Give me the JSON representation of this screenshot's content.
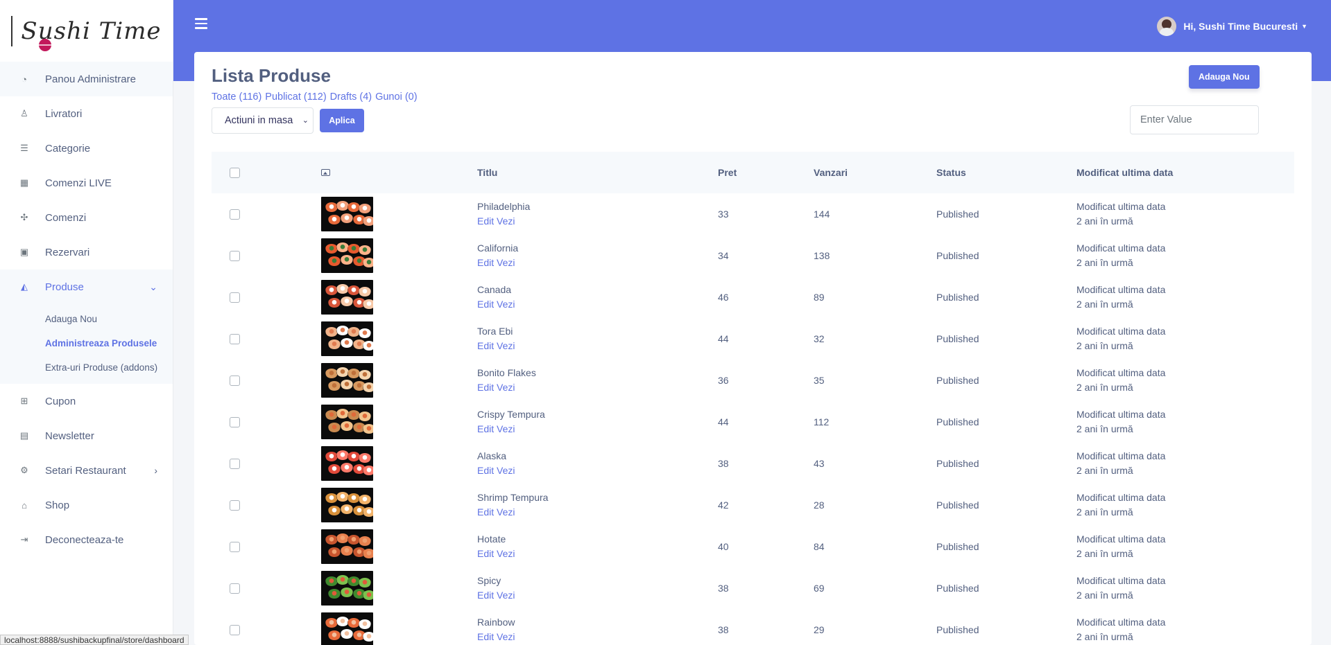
{
  "brand": {
    "logo_text": "Sushi Time"
  },
  "sidebar": {
    "items": [
      {
        "label": "Panou Administrare",
        "icon": "dashboard-icon"
      },
      {
        "label": "Livratori",
        "icon": "user-icon"
      },
      {
        "label": "Categorie",
        "icon": "list-icon"
      },
      {
        "label": "Comenzi LIVE",
        "icon": "grid-icon"
      },
      {
        "label": "Comenzi",
        "icon": "biohazard-icon"
      },
      {
        "label": "Rezervari",
        "icon": "calendar-icon"
      },
      {
        "label": "Produse",
        "icon": "pizza-slice-icon"
      },
      {
        "label": "Cupon",
        "icon": "gift-icon"
      },
      {
        "label": "Newsletter",
        "icon": "newspaper-icon"
      },
      {
        "label": "Setari Restaurant",
        "icon": "cogs-icon"
      },
      {
        "label": "Shop",
        "icon": "store-icon"
      },
      {
        "label": "Deconecteaza-te",
        "icon": "sign-out-icon"
      }
    ],
    "sub_items": [
      {
        "label": "Adauga Nou"
      },
      {
        "label": "Administreaza Produsele"
      },
      {
        "label": "Extra-uri Produse (addons)"
      }
    ]
  },
  "header": {
    "greeting": "Hi, Sushi Time Bucuresti"
  },
  "page": {
    "title": "Lista Produse",
    "add_new_label": "Adauga Nou",
    "filters": [
      "Toate (116)",
      "Publicat (112)",
      "Drafts (4)",
      "Gunoi (0)"
    ],
    "bulk_action": "Actiuni in masa",
    "apply_label": "Aplica",
    "search_placeholder": "Enter Value"
  },
  "table": {
    "columns": [
      "Titlu",
      "Pret",
      "Vanzari",
      "Status",
      "Modificat ultima data"
    ],
    "rows": [
      {
        "title": "Philadelphia",
        "links": "Edit Vezi",
        "price": "33",
        "sales": "144",
        "status": "Published",
        "mod_label": "Modificat ultima data",
        "mod_time": "2 ani în urmă"
      },
      {
        "title": "California",
        "links": "Edit Vezi",
        "price": "34",
        "sales": "138",
        "status": "Published",
        "mod_label": "Modificat ultima data",
        "mod_time": "2 ani în urmă"
      },
      {
        "title": "Canada",
        "links": "Edit Vezi",
        "price": "46",
        "sales": "89",
        "status": "Published",
        "mod_label": "Modificat ultima data",
        "mod_time": "2 ani în urmă"
      },
      {
        "title": "Tora Ebi",
        "links": "Edit Vezi",
        "price": "44",
        "sales": "32",
        "status": "Published",
        "mod_label": "Modificat ultima data",
        "mod_time": "2 ani în urmă"
      },
      {
        "title": "Bonito Flakes",
        "links": "Edit Vezi",
        "price": "36",
        "sales": "35",
        "status": "Published",
        "mod_label": "Modificat ultima data",
        "mod_time": "2 ani în urmă"
      },
      {
        "title": "Crispy Tempura",
        "links": "Edit Vezi",
        "price": "44",
        "sales": "112",
        "status": "Published",
        "mod_label": "Modificat ultima data",
        "mod_time": "2 ani în urmă"
      },
      {
        "title": "Alaska",
        "links": "Edit Vezi",
        "price": "38",
        "sales": "43",
        "status": "Published",
        "mod_label": "Modificat ultima data",
        "mod_time": "2 ani în urmă"
      },
      {
        "title": "Shrimp Tempura",
        "links": "Edit Vezi",
        "price": "42",
        "sales": "28",
        "status": "Published",
        "mod_label": "Modificat ultima data",
        "mod_time": "2 ani în urmă"
      },
      {
        "title": "Hotate",
        "links": "Edit Vezi",
        "price": "40",
        "sales": "84",
        "status": "Published",
        "mod_label": "Modificat ultima data",
        "mod_time": "2 ani în urmă"
      },
      {
        "title": "Spicy",
        "links": "Edit Vezi",
        "price": "38",
        "sales": "69",
        "status": "Published",
        "mod_label": "Modificat ultima data",
        "mod_time": "2 ani în urmă"
      },
      {
        "title": "Rainbow",
        "links": "Edit Vezi",
        "price": "38",
        "sales": "29",
        "status": "Published",
        "mod_label": "Modificat ultima data",
        "mod_time": "2 ani în urmă"
      }
    ]
  },
  "statusbar": {
    "url": "localhost:8888/sushibackupfinal/store/dashboard"
  },
  "colors": {
    "accent": "#5e72e4",
    "text": "#525f7f",
    "thumb_bg": "#0b0b0b"
  }
}
